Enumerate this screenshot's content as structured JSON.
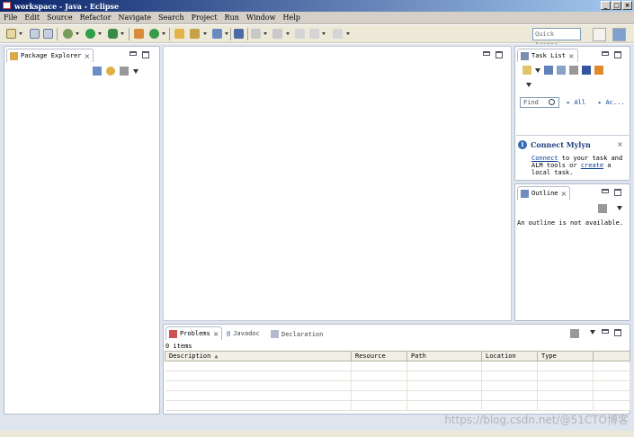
{
  "window": {
    "title": "workspace - Java - Eclipse",
    "buttons": [
      "_",
      "□",
      "×"
    ]
  },
  "menubar": {
    "items": [
      "File",
      "Edit",
      "Source",
      "Refactor",
      "Navigate",
      "Search",
      "Project",
      "Run",
      "Window",
      "Help"
    ]
  },
  "toolbar": {
    "quick_access_placeholder": "Quick Access",
    "icons": [
      "new-icon",
      "save-icon",
      "save-all-icon",
      "debug-icon",
      "run-icon",
      "run-external-icon",
      "new-java-project-icon",
      "new-class-icon",
      "open-type-icon",
      "open-task-icon",
      "search-icon",
      "toggle-mark-icon",
      "next-annotation-icon",
      "prev-annotation-icon",
      "back-icon",
      "forward-icon"
    ],
    "perspective_icons": [
      "open-perspective-icon",
      "java-perspective-icon"
    ]
  },
  "package_explorer": {
    "tab_label": "Package Explorer",
    "tab_close": "×"
  },
  "task_list": {
    "tab_label": "Task List",
    "tab_close": "×",
    "find_placeholder": "Find",
    "links": [
      "All",
      "Ac..."
    ]
  },
  "mylyn": {
    "title": "Connect Mylyn",
    "close": "×",
    "body_link_connect": "Connect",
    "body_text_1": " to your task and ALM tools or ",
    "body_link_create": "create",
    "body_text_2": " a local task."
  },
  "outline": {
    "tab_label": "Outline",
    "tab_close": "×",
    "message": "An outline is not available."
  },
  "bottom_panel": {
    "tabs": [
      {
        "label": "Problems",
        "close": "×"
      },
      {
        "label": "Javadoc"
      },
      {
        "label": "Declaration"
      }
    ],
    "count_text": "0 items",
    "columns": [
      "Description",
      "Resource",
      "Path",
      "Location",
      "Type"
    ],
    "sort_indicator": "▲"
  },
  "watermark": "https://blog.csdn.net/@51CTO博客",
  "colors": {
    "title_gradient_start": "#0a246a",
    "title_gradient_end": "#a6caf0",
    "workbench_bg": "#dfe5ee",
    "link": "#0a3c9a",
    "mylyn_title": "#1f3f82"
  }
}
